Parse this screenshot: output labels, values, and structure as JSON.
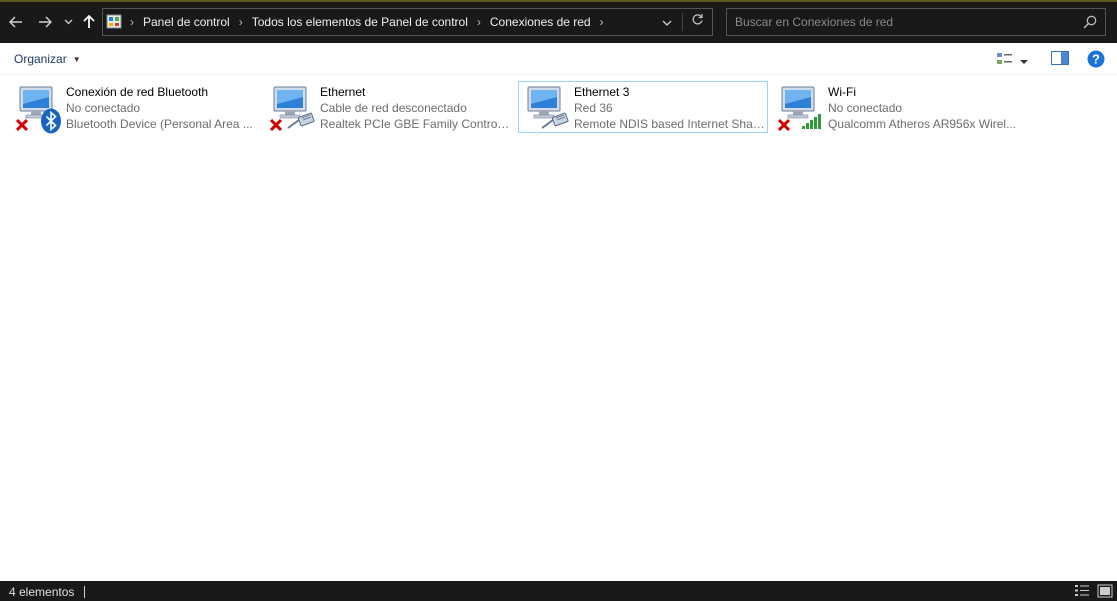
{
  "navigation": {
    "back_icon": "arrow-left-icon",
    "forward_icon": "arrow-right-icon",
    "recent_icon": "chevron-down-icon",
    "up_icon": "arrow-up-icon"
  },
  "address_bar": {
    "breadcrumbs": [
      "Panel de control",
      "Todos los elementos de Panel de control",
      "Conexiones de red"
    ]
  },
  "search": {
    "placeholder": "Buscar en Conexiones de red"
  },
  "command_bar": {
    "organize_label": "Organizar"
  },
  "connections": [
    {
      "name": "Conexión de red Bluetooth",
      "status": "No conectado",
      "device": "Bluetooth Device (Personal Area ...",
      "type": "bluetooth",
      "disconnected": true,
      "selected": false
    },
    {
      "name": "Ethernet",
      "status": "Cable de red desconectado",
      "device": "Realtek PCIe GBE Family Controller",
      "type": "ethernet",
      "disconnected": true,
      "selected": false
    },
    {
      "name": "Ethernet 3",
      "status": "Red 36",
      "device": "Remote NDIS based Internet Shari...",
      "type": "ethernet",
      "disconnected": false,
      "selected": true
    },
    {
      "name": "Wi-Fi",
      "status": "No conectado",
      "device": "Qualcomm Atheros AR956x Wirel...",
      "type": "wifi",
      "disconnected": true,
      "selected": false
    }
  ],
  "status_bar": {
    "item_count": "4 elementos"
  },
  "colors": {
    "dark_chrome": "#191919",
    "selection_border": "#99d1ff",
    "help_blue": "#1a73d9",
    "disconnect_red": "#d40000"
  }
}
